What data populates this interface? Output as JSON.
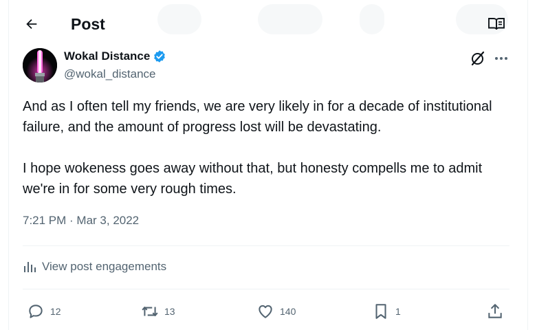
{
  "header": {
    "title": "Post",
    "back_icon": "arrow-left-icon",
    "reader_icon": "open-book-icon"
  },
  "author": {
    "display_name": "Wokal Distance",
    "handle": "@wokal_distance",
    "verified_icon": "verified-badge-icon",
    "avatar": "pink-lightsaber-avatar"
  },
  "post": {
    "paragraphs": [
      "And as I often tell my friends, we are very likely in for a decade of institutional failure, and the amount of progress lost will be devastating.",
      "I hope wokeness goes away without that, but honesty compells me to admit we're in for some very rough times."
    ],
    "timestamp": "7:21 PM · Mar 3, 2022"
  },
  "engagements": {
    "label": "View post engagements",
    "icon": "analytics-bars-icon"
  },
  "actions": {
    "replies": "12",
    "reposts": "13",
    "likes": "140",
    "bookmarks": "1"
  },
  "colors": {
    "text": "#0f1419",
    "muted": "#536471",
    "verified": "#1d9bf0",
    "divider": "#eff3f4"
  }
}
